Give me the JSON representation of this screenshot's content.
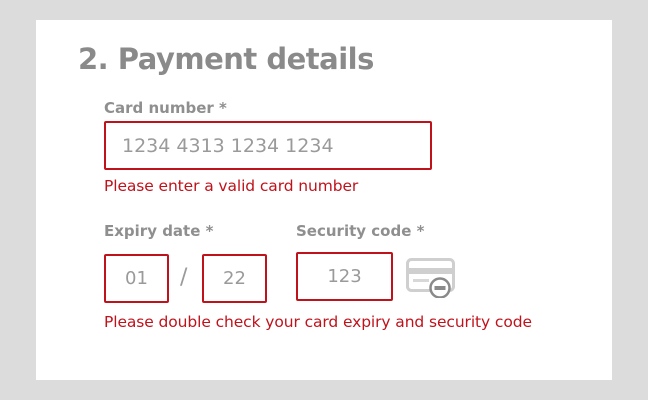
{
  "section": {
    "title": "2. Payment details"
  },
  "card_number": {
    "label": "Card number *",
    "placeholder": "1234 4313 1234 1234",
    "error": "Please enter a valid card number"
  },
  "expiry": {
    "label": "Expiry date *",
    "month_placeholder": "01",
    "separator": "/",
    "year_placeholder": "22"
  },
  "security": {
    "label": "Security code *",
    "placeholder": "123",
    "icon": "card-cvv-icon"
  },
  "expiry_security_error": "Please double check your card expiry and security code",
  "colors": {
    "error": "#c0121b",
    "label": "#8f8f8f",
    "background": "#dcdcdc",
    "panel": "#ffffff"
  }
}
